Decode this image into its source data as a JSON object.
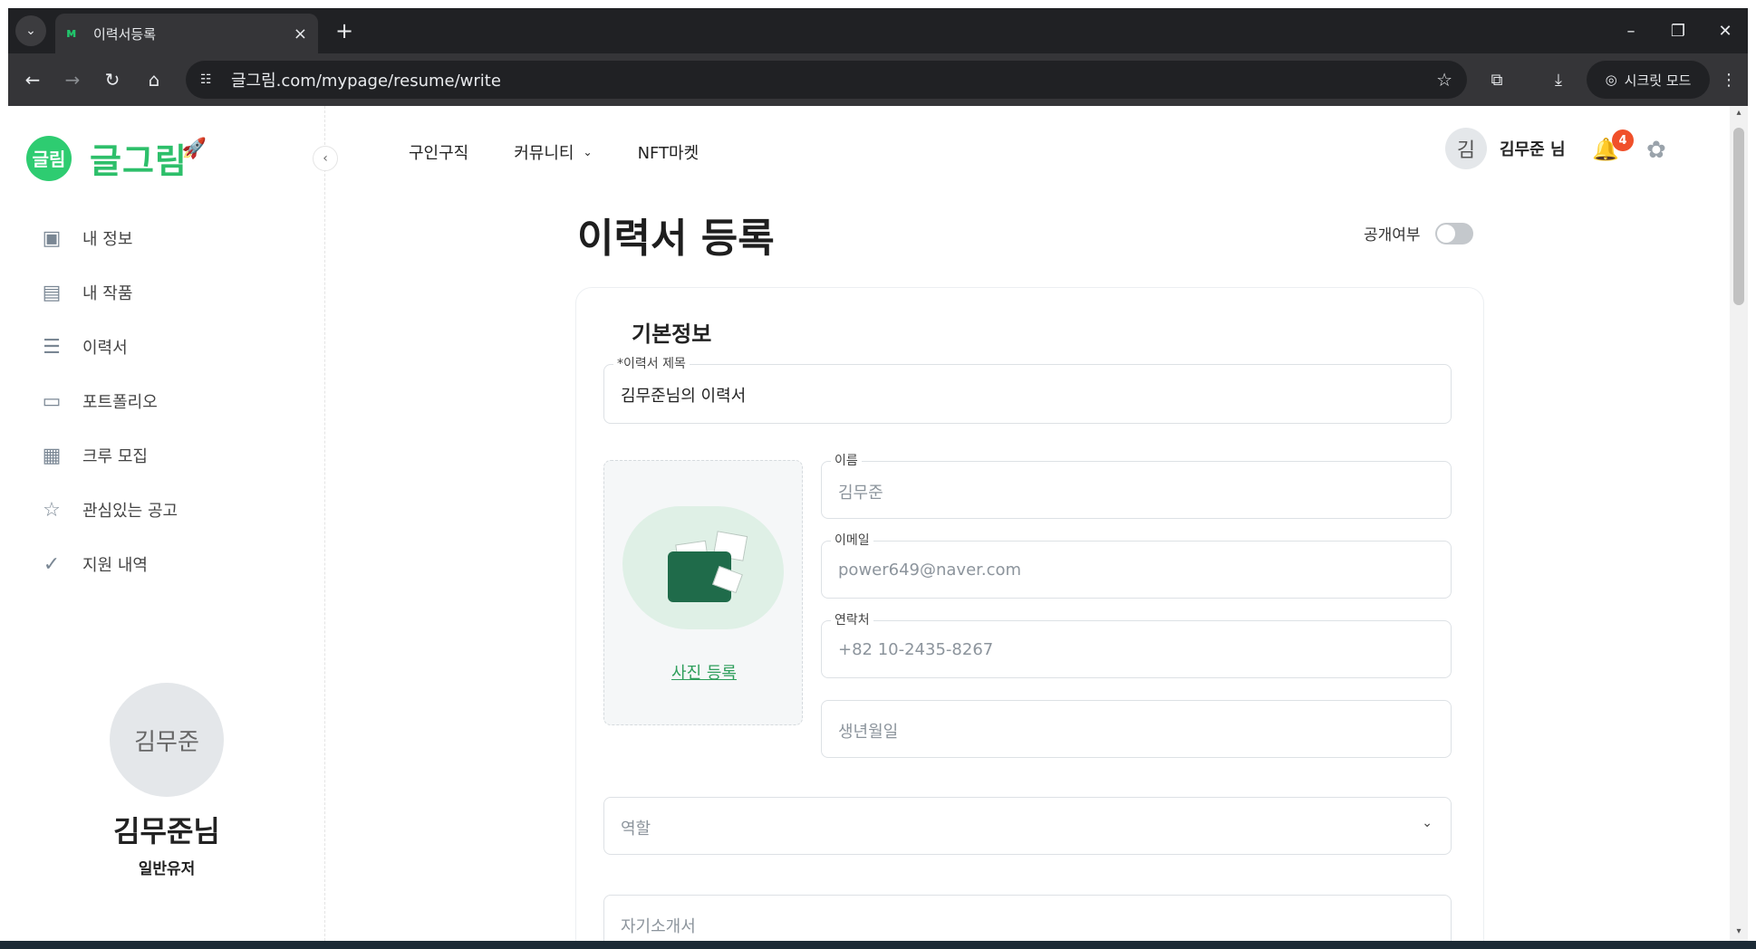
{
  "browser": {
    "tab_title": "이력서등록",
    "url": "글그림.com/mypage/resume/write",
    "incognito_label": "시크릿 모드",
    "new_tab_symbol": "+",
    "tab_close_symbol": "×"
  },
  "sidebar": {
    "logo_badge": "글림",
    "logo_text": "글그림",
    "items": [
      {
        "label": "내 정보",
        "icon": "user-card-icon"
      },
      {
        "label": "내 작품",
        "icon": "archive-icon"
      },
      {
        "label": "이력서",
        "icon": "resume-list-icon"
      },
      {
        "label": "포트폴리오",
        "icon": "portfolio-icon"
      },
      {
        "label": "크루 모집",
        "icon": "calendar-icon"
      },
      {
        "label": "관심있는 공고",
        "icon": "star-icon"
      },
      {
        "label": "지원 내역",
        "icon": "check-circle-icon"
      }
    ],
    "profile": {
      "avatar_text": "김무준",
      "name": "김무준님",
      "role": "일반유저"
    }
  },
  "topnav": {
    "items": [
      "구인구직",
      "커뮤니티",
      "NFT마켓"
    ],
    "user_avatar": "김",
    "user_name": "김무준 님",
    "notification_count": "4"
  },
  "main": {
    "page_title": "이력서 등록",
    "public_label": "공개여부",
    "public_enabled": false,
    "section_title": "기본정보",
    "resume_title": {
      "label": "*이력서 제목",
      "value": "김무준님의 이력서"
    },
    "name": {
      "label": "이름",
      "value": "김무준"
    },
    "email": {
      "label": "이메일",
      "value": "power649@naver.com"
    },
    "phone": {
      "label": "연락처",
      "value": "+82 10-2435-8267"
    },
    "birth": {
      "placeholder": "생년월일"
    },
    "role": {
      "placeholder": "역할"
    },
    "intro": {
      "placeholder": "자기소개서"
    },
    "photo_link": "사진 등록"
  }
}
